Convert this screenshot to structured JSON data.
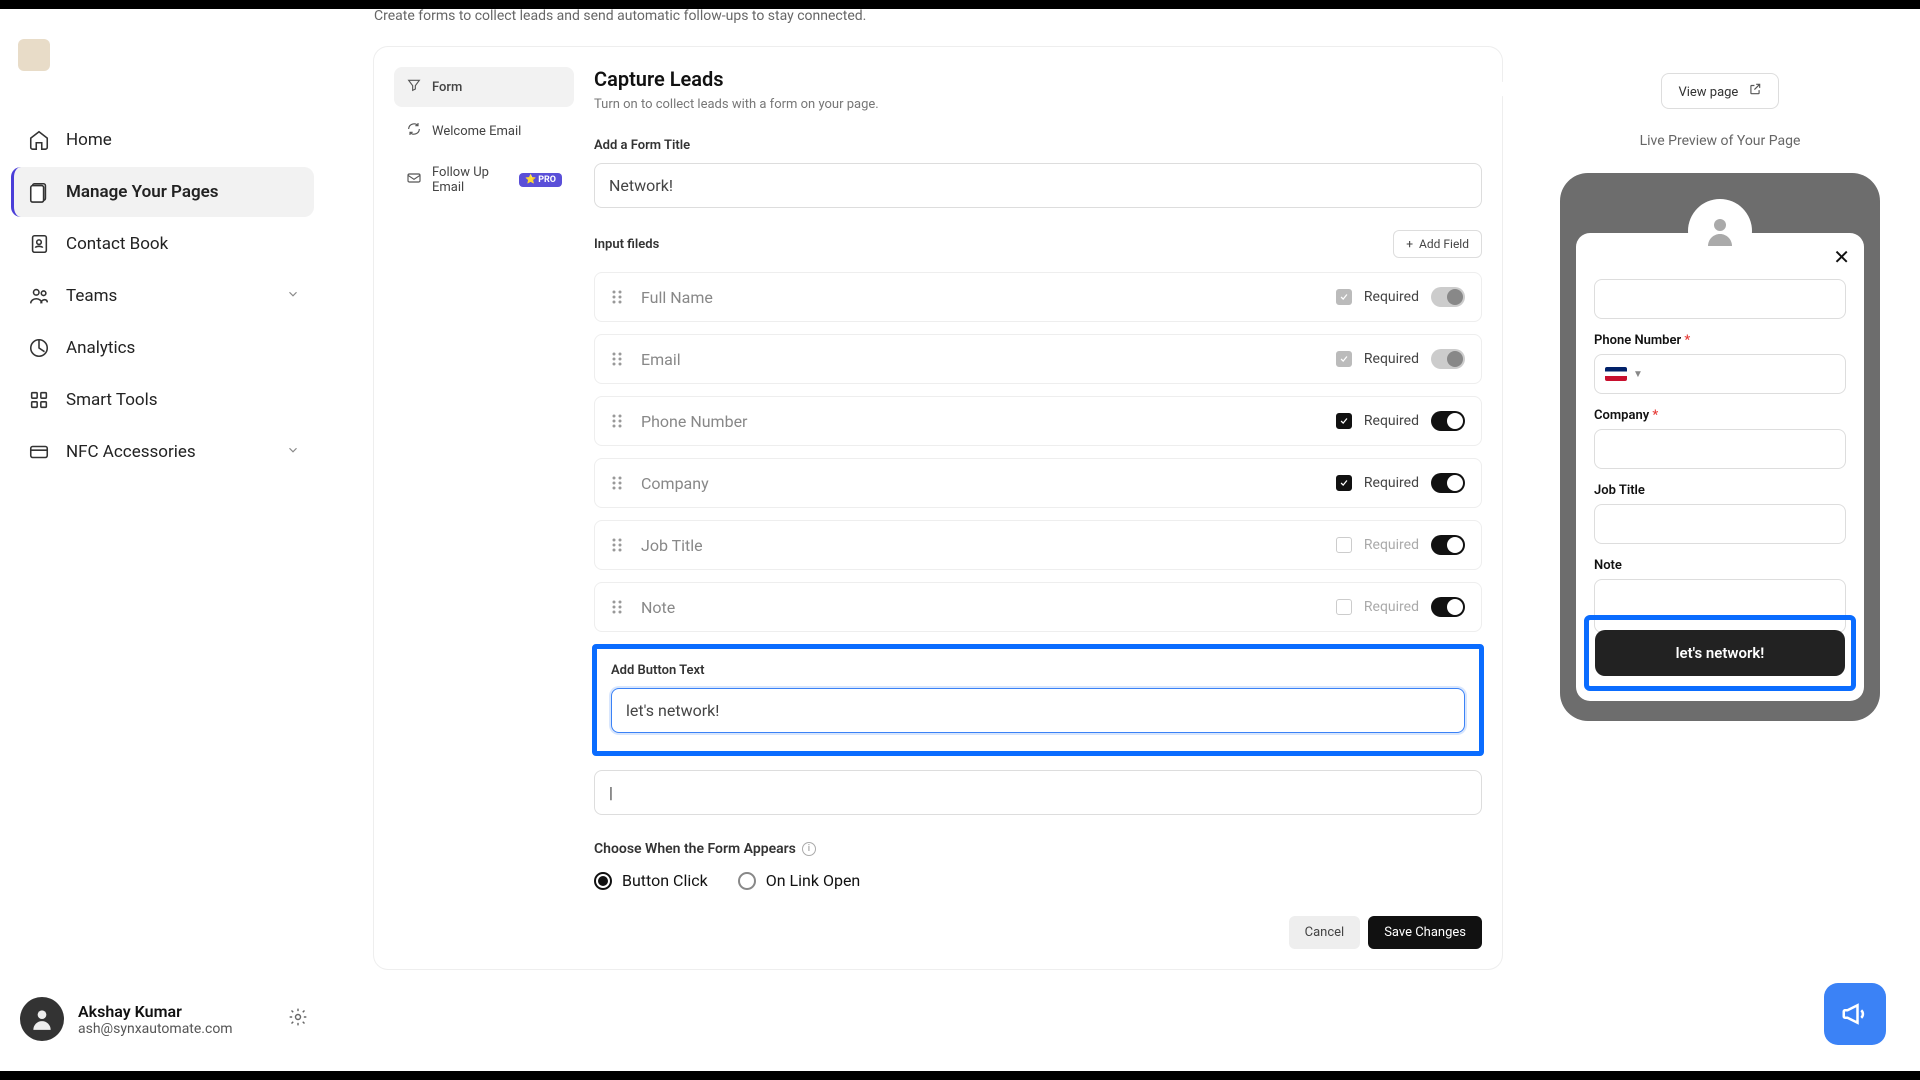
{
  "page_subheader": "Create forms to collect leads and send automatic follow-ups to stay connected.",
  "sidebar": {
    "items": [
      {
        "label": "Home"
      },
      {
        "label": "Manage Your Pages"
      },
      {
        "label": "Contact Book"
      },
      {
        "label": "Teams"
      },
      {
        "label": "Analytics"
      },
      {
        "label": "Smart Tools"
      },
      {
        "label": "NFC Accessories"
      }
    ],
    "user_name": "Akshay Kumar",
    "user_email": "ash@synxautomate.com"
  },
  "form_tabs": {
    "form": "Form",
    "welcome": "Welcome Email",
    "followup": "Follow Up Email",
    "pro_badge": "PRO"
  },
  "capture": {
    "title": "Capture Leads",
    "subtitle": "Turn on to collect leads with a form on your page.",
    "title_label": "Add a Form Title",
    "title_value": "Network!",
    "input_fields_label": "Input fileds",
    "add_field": "Add Field",
    "fields": [
      {
        "name": "Full Name",
        "required_checked": true,
        "required_locked": true,
        "toggle_on": false
      },
      {
        "name": "Email",
        "required_checked": true,
        "required_locked": true,
        "toggle_on": false
      },
      {
        "name": "Phone Number",
        "required_checked": true,
        "required_locked": false,
        "toggle_on": true
      },
      {
        "name": "Company",
        "required_checked": true,
        "required_locked": false,
        "toggle_on": true
      },
      {
        "name": "Job Title",
        "required_checked": false,
        "required_locked": false,
        "toggle_on": true
      },
      {
        "name": "Note",
        "required_checked": false,
        "required_locked": false,
        "toggle_on": true
      }
    ],
    "required_label": "Required",
    "button_text_label": "Add Button Text",
    "button_text_value": "let's network!",
    "disclaimer_value": "|",
    "appears_label": "Choose When the Form Appears",
    "radio_button_click": "Button Click",
    "radio_link_open": "On Link Open",
    "cancel": "Cancel",
    "save": "Save Changes"
  },
  "preview": {
    "view_page": "View page",
    "live_label": "Live Preview of Your Page",
    "phone_label": "Phone Number",
    "company_label": "Company",
    "job_label": "Job Title",
    "note_label": "Note",
    "submit": "let's network!"
  }
}
